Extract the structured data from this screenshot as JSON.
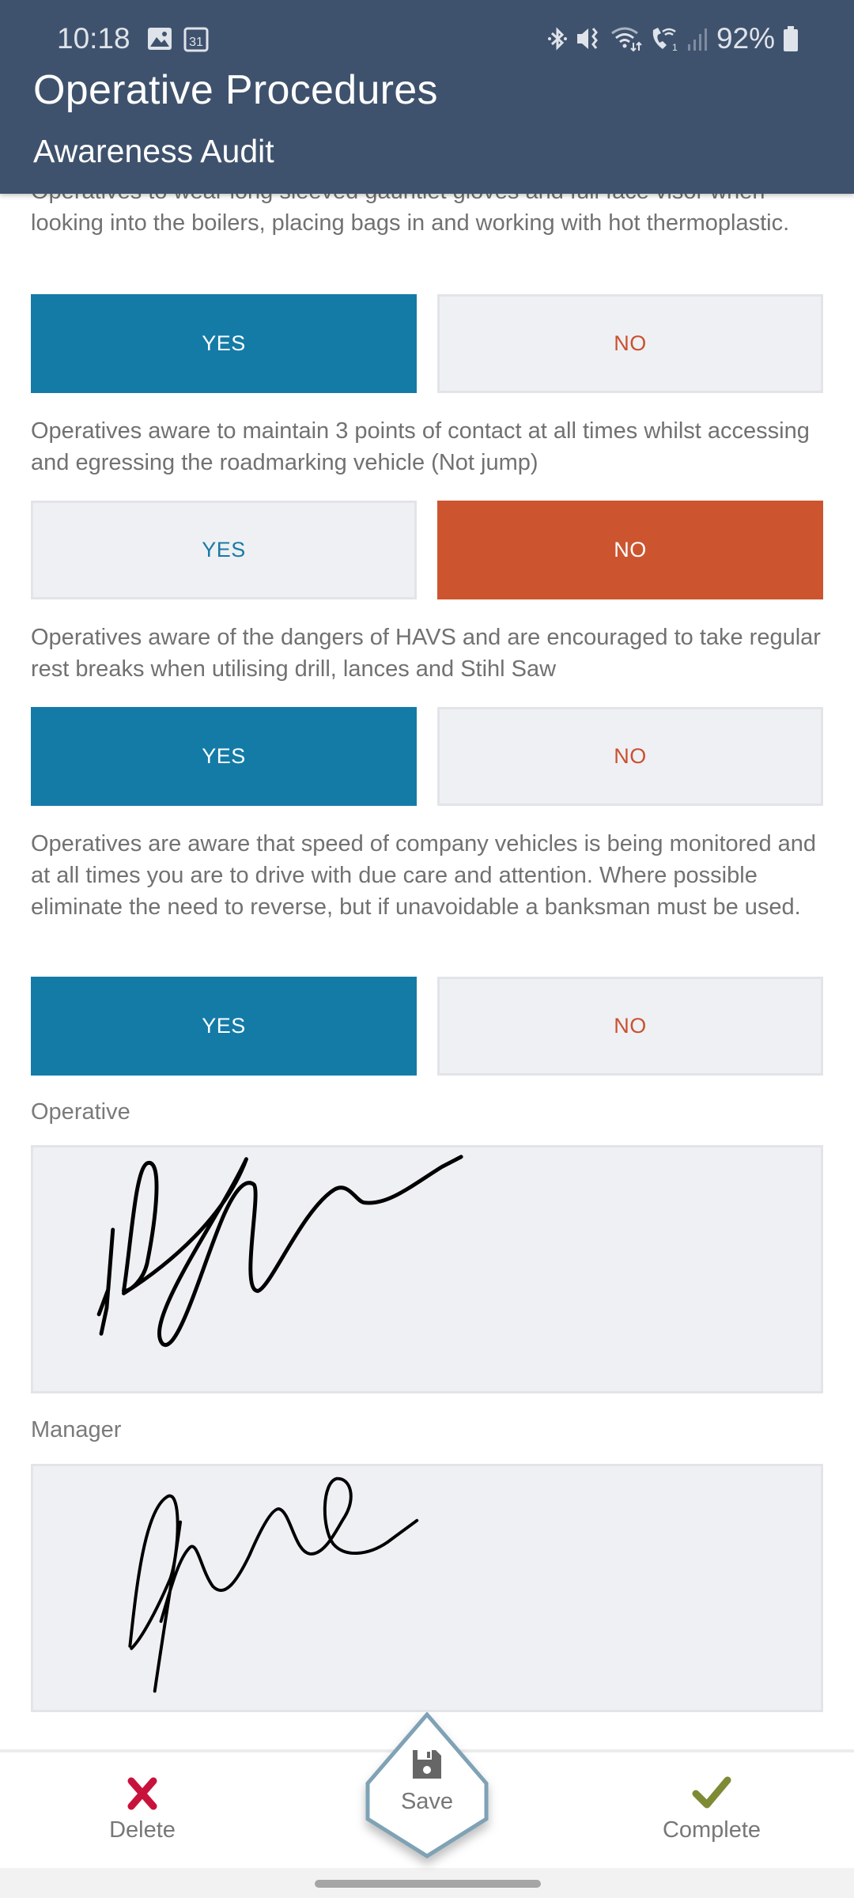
{
  "status_bar": {
    "time": "10:18",
    "left_icons": [
      "gallery-icon",
      "calendar-31-icon"
    ],
    "calendar_day": "31",
    "right_icons": [
      "bluetooth-icon",
      "mute-vibrate-icon",
      "wifi-icon",
      "wifi-calling-icon",
      "signal-icon",
      "battery-icon"
    ],
    "battery": "92%"
  },
  "header": {
    "title": "Operative Procedures",
    "subtitle": "Awareness Audit"
  },
  "questions": [
    {
      "text": "Operatives to wear long sleeved gauntlet gloves and full face visor when looking into the boilers, placing bags in and working with hot thermoplastic.",
      "yes_label": "YES",
      "no_label": "NO",
      "answer": "YES"
    },
    {
      "text": "Operatives aware to maintain 3 points of contact at all times whilst accessing and egressing the roadmarking vehicle (Not jump)",
      "yes_label": "YES",
      "no_label": "NO",
      "answer": "NO"
    },
    {
      "text": "Operatives aware of the dangers of HAVS and are encouraged to take regular rest breaks when utilising drill, lances and Stihl Saw",
      "yes_label": "YES",
      "no_label": "NO",
      "answer": "YES"
    },
    {
      "text": "Operatives are aware that speed of company vehicles is being monitored and at all times you are to drive with due care and attention. Where possible eliminate the need to reverse, but if unavoidable a banksman must be used.",
      "yes_label": "YES",
      "no_label": "NO",
      "answer": "YES"
    }
  ],
  "signatures": {
    "operative": {
      "label": "Operative",
      "signed": true
    },
    "manager": {
      "label": "Manager",
      "signed": true
    }
  },
  "bottom_bar": {
    "delete_label": "Delete",
    "save_label": "Save",
    "complete_label": "Complete"
  },
  "colors": {
    "header_bg": "#3f526d",
    "yes_active": "#147ba7",
    "no_active": "#cc5530",
    "button_inactive_bg": "#eff0f4",
    "delete_icon": "#c8123c",
    "complete_icon": "#7f8a35",
    "save_hex_border": "#7fa2b5"
  }
}
